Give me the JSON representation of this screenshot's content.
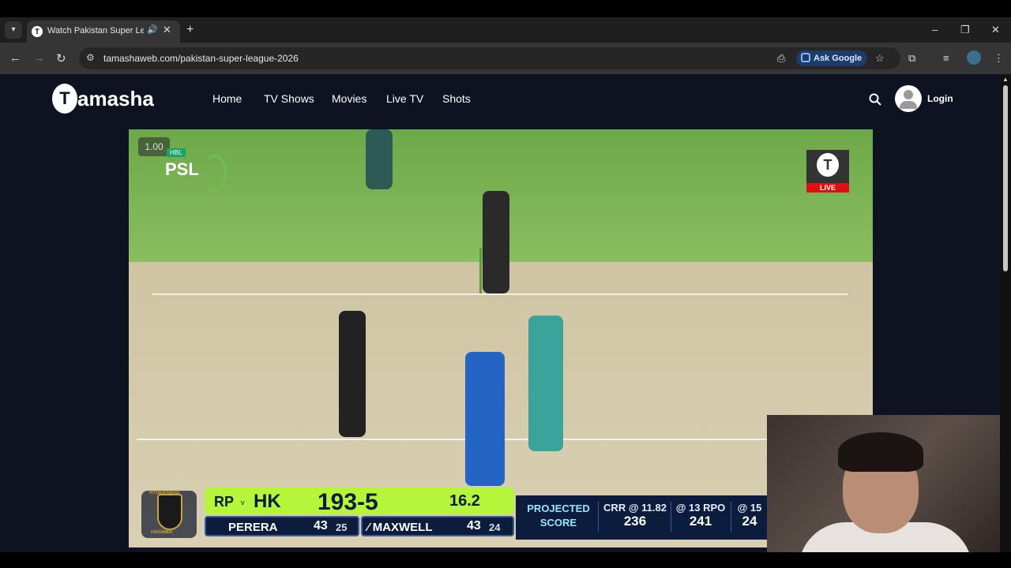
{
  "browser": {
    "tab_title": "Watch Pakistan Super League",
    "new_tab_symbol": "+",
    "url": "tamashaweb.com/pakistan-super-league-2026",
    "ask_google_label": "Ask Google",
    "window_controls": {
      "minimize": "–",
      "restore": "❐",
      "close": "✕"
    },
    "nav": {
      "back": "←",
      "forward": "→",
      "reload": "↻"
    }
  },
  "site": {
    "logo_text": "amasha",
    "nav_items": [
      {
        "label": "Home"
      },
      {
        "label": "TV Shows"
      },
      {
        "label": "Movies"
      },
      {
        "label": "Live TV"
      },
      {
        "label": "Shots"
      }
    ],
    "login_label": "Login"
  },
  "player": {
    "speed": "1.00",
    "broadcast_logo": "PSL",
    "broadcast_sponsor": "HBL",
    "live_label": "LIVE"
  },
  "scoreboard": {
    "crest_top": "HYDERABAD",
    "crest_bottom": "KINGSMEN",
    "team1": "RP",
    "vs": "v",
    "team2": "HK",
    "score": "193-5",
    "overs": "16.2",
    "batters": [
      {
        "name": "PERERA",
        "runs": "43",
        "balls": "25",
        "on_strike": false
      },
      {
        "name": "MAXWELL",
        "runs": "43",
        "balls": "24",
        "on_strike": true
      }
    ],
    "projected_label_line1": "PROJECTED",
    "projected_label_line2": "SCORE",
    "projections": [
      {
        "label": "CRR @ 11.82",
        "value": "236"
      },
      {
        "label": "@ 13 RPO",
        "value": "241"
      },
      {
        "label": "@ 15",
        "value": "24"
      }
    ]
  },
  "colors": {
    "accent_scoreboard": "#b5f53a",
    "scoreboard_bg": "#0b1c3d",
    "live_red": "#dd1111"
  }
}
